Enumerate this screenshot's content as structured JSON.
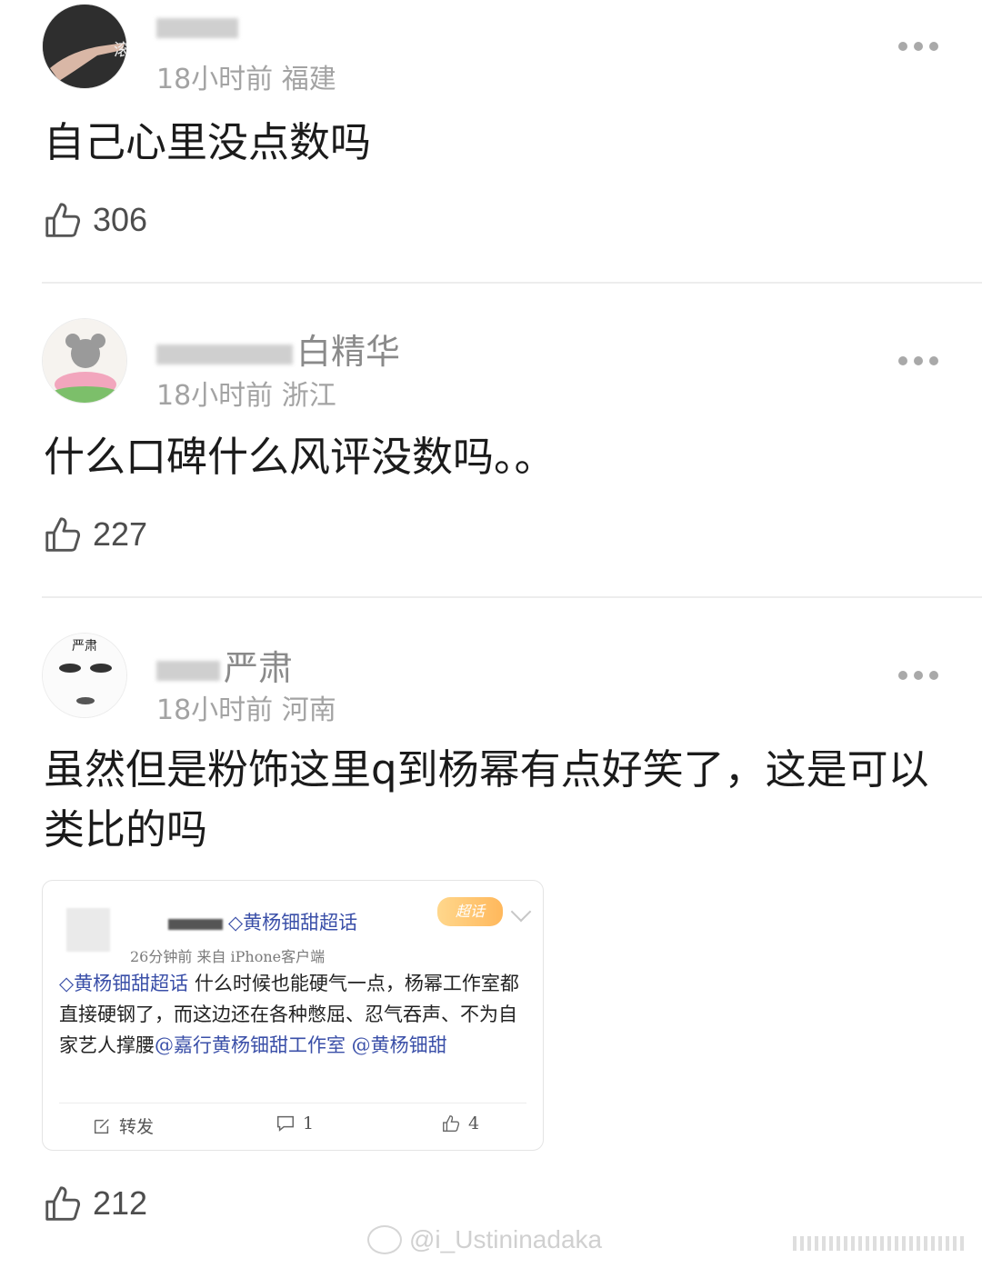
{
  "comments": [
    {
      "avatar_icon": "pointing-hand-avatar-icon",
      "avatar_text": "滚",
      "name_visible": "",
      "meta": "18小时前 福建",
      "text": "自己心里没点数吗",
      "likes": "306"
    },
    {
      "avatar_icon": "mouse-on-lotus-avatar-icon",
      "name_visible": "白精华",
      "meta": "18小时前 浙江",
      "text": "什么口碑什么风评没数吗。。",
      "likes": "227"
    },
    {
      "avatar_icon": "face-sketch-avatar-icon",
      "avatar_text": "严肃",
      "name_visible": "严肃",
      "meta": "18小时前 河南",
      "text": "虽然但是粉饰这里q到杨幂有点好笑了，这是可以类比的吗",
      "likes": "212"
    }
  ],
  "embedded_post": {
    "name_topic": "◇黄杨钿甜超话",
    "badge": "超话",
    "meta": "26分钟前  来自 iPhone客户端",
    "topic": "◇黄杨钿甜超话",
    "body": " 什么时候也能硬气一点，杨幂工作室都直接硬钢了，而这边还在各种憋屈、忍气吞声、不为自家艺人撑腰",
    "mentions": "@嘉行黄杨钿甜工作室 @黄杨钿甜",
    "repost_label": "转发",
    "comment_count": "1",
    "like_count": "4"
  },
  "watermark": "@i_Ustininadaka",
  "colors": {
    "topic_blue": "#3a4fa8",
    "meta_gray": "#a3a3a3",
    "divider": "#ededed"
  }
}
